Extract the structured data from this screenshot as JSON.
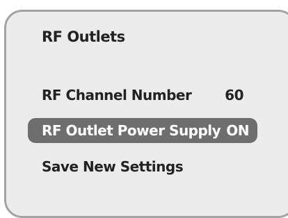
{
  "menu": {
    "title": "RF Outlets",
    "items": [
      {
        "label": "RF Channel Number",
        "value": "60",
        "selected": false
      },
      {
        "label": "RF Outlet Power Supply",
        "value": "ON",
        "selected": true
      },
      {
        "label": "Save New Settings",
        "value": "",
        "selected": false
      }
    ]
  },
  "colors": {
    "panel_background": "#ececec",
    "panel_border": "#a3a3a3",
    "selection_highlight": "#6e6e6e",
    "text": "#222222",
    "selected_text": "#ffffff"
  }
}
